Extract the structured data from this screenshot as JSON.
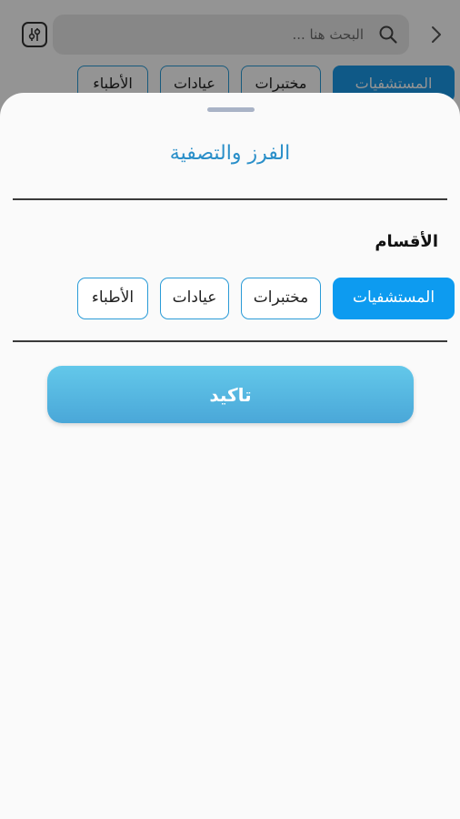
{
  "background": {
    "search": {
      "placeholder": "البحث هنا ..."
    },
    "chips": [
      {
        "label": "المستشفيات",
        "active": true
      },
      {
        "label": "مختبرات",
        "active": false
      },
      {
        "label": "عيادات",
        "active": false
      },
      {
        "label": "الأطباء",
        "active": false
      }
    ]
  },
  "sheet": {
    "title": "الفرز والتصفية",
    "section_label": "الأقسام",
    "chips": [
      {
        "label": "المستشفيات",
        "active": true
      },
      {
        "label": "مختبرات",
        "active": false
      },
      {
        "label": "عيادات",
        "active": false
      },
      {
        "label": "الأطباء",
        "active": false
      }
    ],
    "confirm_label": "تاكيد"
  },
  "colors": {
    "accent": "#0d9bf0",
    "title": "#2a8fc9",
    "button_gradient_top": "#63c8ea",
    "button_gradient_bottom": "#4aa7d8"
  }
}
